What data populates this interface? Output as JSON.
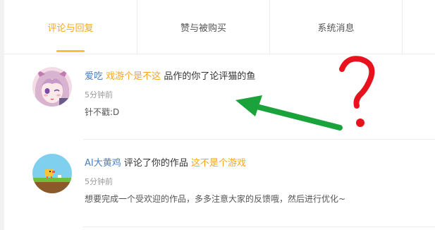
{
  "tabs": [
    {
      "label": "评论与回复",
      "active": true
    },
    {
      "label": "赞与被购买",
      "active": false
    },
    {
      "label": "系统消息",
      "active": false
    }
  ],
  "notifications": [
    {
      "user": "爱吃",
      "game": "戏游个是不这",
      "action": "品作的你了论评猫的鱼",
      "time": "5分钟前",
      "content": "针不戳:D"
    },
    {
      "user": "AI大黄鸡",
      "action": "评论了你的作品",
      "game": "这不是个游戏",
      "time": "5分钟前",
      "content": "想要完成一个受欢迎的作品，多多注意大家的反馈哦，然后进行优化~"
    }
  ],
  "colors": {
    "accent": "#f5a623",
    "link": "#4a7fc1",
    "annotation_arrow": "#1aa33a",
    "annotation_mark": "#e8121e"
  }
}
